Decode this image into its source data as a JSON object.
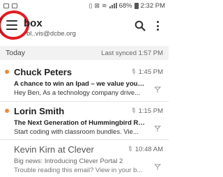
{
  "status_bar": {
    "battery": "68%",
    "time": "2:32 PM"
  },
  "header": {
    "title": "Inbox",
    "visible_title": "box",
    "email": "bl..vis@dcbe.org",
    "menu_icon": "hamburger-menu-icon",
    "search_icon": "search-icon",
    "more_icon": "more-vert-icon",
    "annotation_color": "#e21c23"
  },
  "section": {
    "title": "Today",
    "sync": "Last synced  1:57 PM"
  },
  "emails": [
    {
      "sender": "Chuck Peters",
      "time": "1:45 PM",
      "subject": "A chance to win an Ipad – we value your l...",
      "preview": "Hey Ben,  As a technology company drive...",
      "unread": true
    },
    {
      "sender": "Lorin Smith",
      "time": "1:15 PM",
      "subject": "The Next Generation of Hummingbird Rob...",
      "preview": "Start coding with classroom bundles. Vie...",
      "unread": true
    },
    {
      "sender": "Kevin Kirn at Clever",
      "time": "10:48 AM",
      "subject": "Big news: Introducing Clever Portal 2",
      "preview": "Trouble reading this email? View in your b...",
      "unread": false
    }
  ],
  "colors": {
    "unread_dot": "#f0893a",
    "section_bg": "#f2f2f2"
  }
}
